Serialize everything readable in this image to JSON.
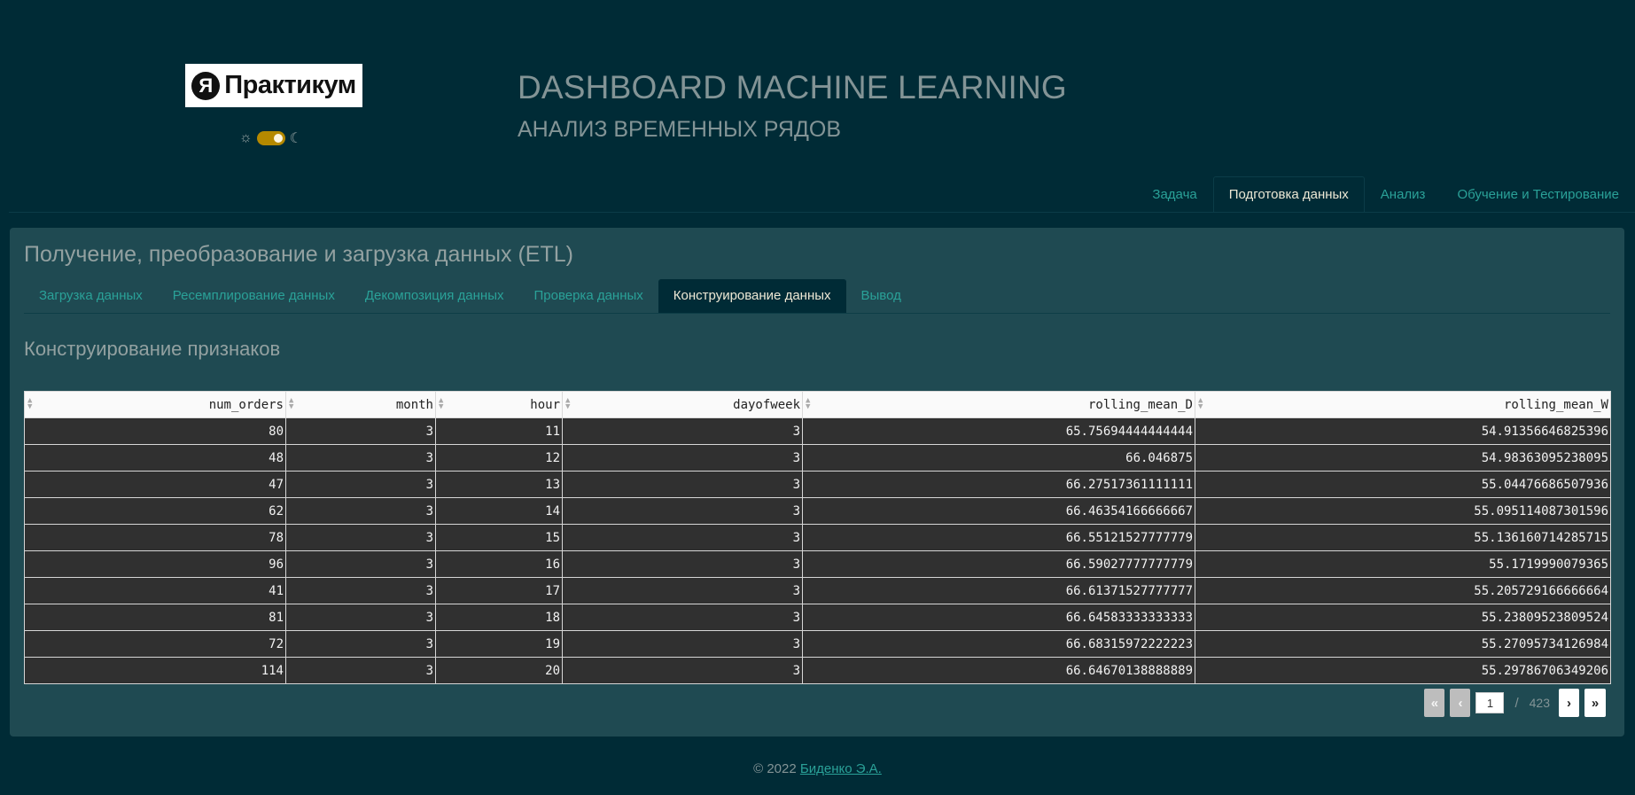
{
  "header": {
    "logo_letter": "Я",
    "logo_text": "Практикум",
    "title": "DASHBOARD MACHINE LEARNING",
    "subtitle": "АНАЛИЗ ВРЕМЕННЫХ РЯДОВ",
    "theme": {
      "sun_icon": "☼",
      "moon_icon": "☾",
      "dark_mode": true
    }
  },
  "nav": {
    "tabs": [
      {
        "label": "Задача"
      },
      {
        "label": "Подготовка данных",
        "active": true
      },
      {
        "label": "Анализ"
      },
      {
        "label": "Обучение и Тестирование"
      }
    ]
  },
  "card": {
    "title": "Получение, преобразование и загрузка данных (ETL)",
    "tabs": [
      {
        "label": "Загрузка данных"
      },
      {
        "label": "Ресемплирование данных"
      },
      {
        "label": "Декомпозиция данных"
      },
      {
        "label": "Проверка данных"
      },
      {
        "label": "Конструирование данных",
        "active": true
      },
      {
        "label": "Вывод"
      }
    ],
    "section_title": "Конструирование признаков"
  },
  "table": {
    "columns": [
      "num_orders",
      "month",
      "hour",
      "dayofweek",
      "rolling_mean_D",
      "rolling_mean_W"
    ],
    "rows": [
      [
        "80",
        "3",
        "11",
        "3",
        "65.75694444444444",
        "54.91356646825396"
      ],
      [
        "48",
        "3",
        "12",
        "3",
        "66.046875",
        "54.98363095238095"
      ],
      [
        "47",
        "3",
        "13",
        "3",
        "66.27517361111111",
        "55.04476686507936"
      ],
      [
        "62",
        "3",
        "14",
        "3",
        "66.46354166666667",
        "55.095114087301596"
      ],
      [
        "78",
        "3",
        "15",
        "3",
        "66.55121527777779",
        "55.136160714285715"
      ],
      [
        "96",
        "3",
        "16",
        "3",
        "66.59027777777779",
        "55.1719990079365"
      ],
      [
        "41",
        "3",
        "17",
        "3",
        "66.61371527777777",
        "55.205729166666664"
      ],
      [
        "81",
        "3",
        "18",
        "3",
        "66.64583333333333",
        "55.23809523809524"
      ],
      [
        "72",
        "3",
        "19",
        "3",
        "66.68315972222223",
        "55.27095734126984"
      ],
      [
        "114",
        "3",
        "20",
        "3",
        "66.64670138888889",
        "55.29786706349206"
      ]
    ]
  },
  "pagination": {
    "first_icon": "«",
    "prev_icon": "‹",
    "next_icon": "›",
    "last_icon": "»",
    "current_page": "1",
    "separator": "/",
    "total_pages": "423"
  },
  "footer": {
    "copyright": "© 2022",
    "author": "Биденко Э.А."
  },
  "colors": {
    "background": "#002b36",
    "card": "#1f4a52",
    "accent": "#2aa198",
    "toggle": "#b58900"
  }
}
